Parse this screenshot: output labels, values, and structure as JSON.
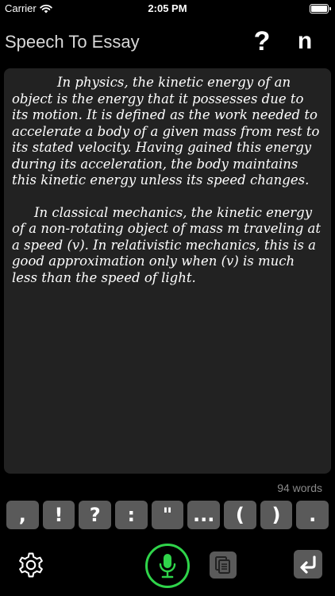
{
  "status_bar": {
    "carrier": "Carrier",
    "time": "2:05 PM"
  },
  "nav": {
    "title": "Speech To Essay",
    "help_label": "?",
    "new_label": "n"
  },
  "essay": {
    "paragraphs": [
      "In physics, the kinetic energy of an object is the energy that it possesses due to its motion. It is defined as the work needed to accelerate a body of a given mass from rest to its stated velocity. Having gained this energy during its acceleration, the body maintains this kinetic energy unless its speed changes.",
      "In classical mechanics, the kinetic energy of a non-rotating object of mass m traveling at a speed (v). In relativistic mechanics, this is a good approximation only when (v) is much less than the speed of light."
    ]
  },
  "word_count": "94 words",
  "punctuation_keys": [
    ",",
    "!",
    "?",
    ":",
    "\"",
    "...",
    "(",
    ")",
    "."
  ],
  "colors": {
    "mic_accent": "#2fd44a",
    "key_background": "#5a5a5a",
    "essay_background": "#222222"
  },
  "icons": {
    "settings": "gear-icon",
    "mic": "microphone-icon",
    "copy": "document-copy-icon",
    "return": "return-arrow-icon"
  }
}
